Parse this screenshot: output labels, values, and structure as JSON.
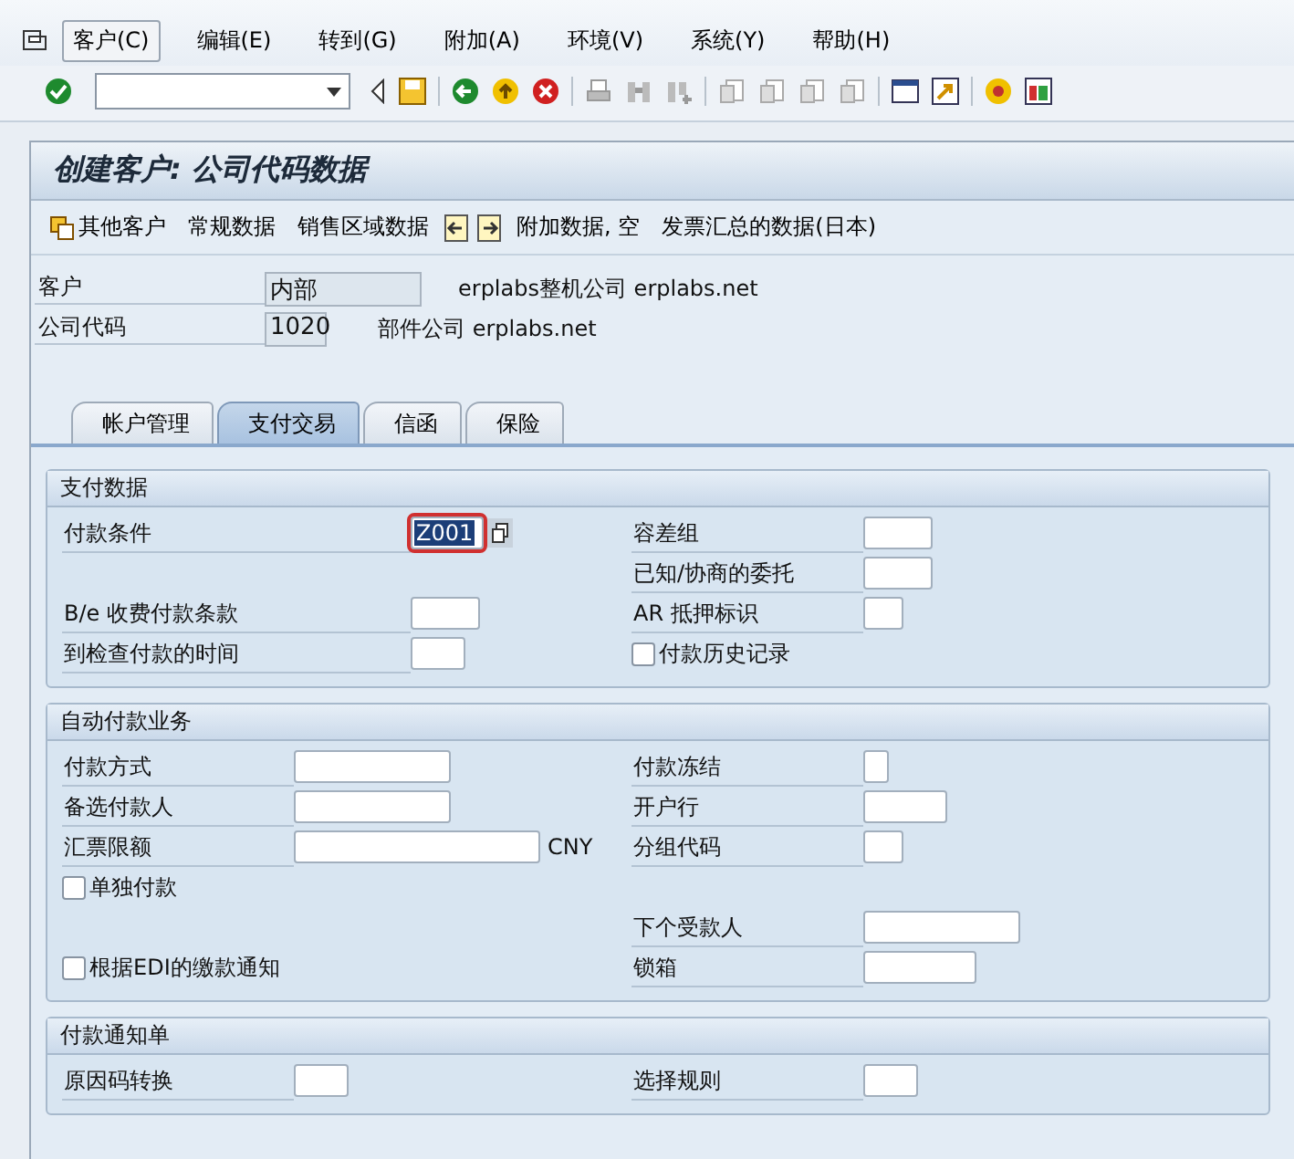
{
  "menu_bar": {
    "items": [
      {
        "label": "客户(C)",
        "selected": true
      },
      {
        "label": "编辑(E)",
        "selected": false
      },
      {
        "label": "转到(G)",
        "selected": false
      },
      {
        "label": "附加(A)",
        "selected": false
      },
      {
        "label": "环境(V)",
        "selected": false
      },
      {
        "label": "系统(Y)",
        "selected": false
      },
      {
        "label": "帮助(H)",
        "selected": false
      }
    ]
  },
  "title": "创建客户: 公司代码数据",
  "app_toolbar": [
    {
      "kind": "icon-text",
      "label": "其他客户"
    },
    {
      "kind": "text",
      "label": "常规数据"
    },
    {
      "kind": "text",
      "label": "销售区域数据"
    },
    {
      "kind": "previous"
    },
    {
      "kind": "next"
    },
    {
      "kind": "text",
      "label": "附加数据, 空"
    },
    {
      "kind": "text",
      "label": "发票汇总的数据(日本)"
    }
  ],
  "header_fields": [
    {
      "label": "客户",
      "value": "内部",
      "description": "erplabs整机公司 erplabs.net"
    },
    {
      "label": "公司代码",
      "value": "1020",
      "description": "部件公司 erplabs.net"
    }
  ],
  "tabs": [
    {
      "label": "帐户管理",
      "selected": false
    },
    {
      "label": "支付交易",
      "selected": true
    },
    {
      "label": "信函",
      "selected": false
    },
    {
      "label": "保险",
      "selected": false
    }
  ],
  "groups": [
    {
      "title": "支付数据",
      "rows": [
        {
          "left": {
            "kind": "field",
            "label": "付款条件",
            "value": "Z001",
            "focused": true
          },
          "right": {
            "kind": "field",
            "label": "容差组",
            "focused": false
          }
        },
        {
          "right": {
            "kind": "field",
            "label": "已知/协商的委托",
            "focused": false
          }
        },
        {
          "left": {
            "kind": "field",
            "label": "B/e 收费付款条款",
            "focused": false
          },
          "right": {
            "kind": "field",
            "label": "AR 抵押标识",
            "focused": false
          }
        },
        {
          "left": {
            "kind": "field",
            "label": "到检查付款的时间",
            "focused": false
          },
          "right": {
            "kind": "checkbox",
            "label": "付款历史记录",
            "checked": false
          }
        }
      ]
    },
    {
      "title": "自动付款业务",
      "rows": [
        {
          "left": {
            "kind": "field",
            "label": "付款方式",
            "focused": false
          },
          "right": {
            "kind": "field",
            "label": "付款冻结",
            "focused": false
          }
        },
        {
          "left": {
            "kind": "field",
            "label": "备选付款人",
            "focused": false
          },
          "right": {
            "kind": "field",
            "label": "开户行",
            "focused": false
          }
        },
        {
          "left": {
            "kind": "field",
            "label": "汇票限额",
            "suffix": "CNY",
            "focused": false
          },
          "right": {
            "kind": "field",
            "label": "分组代码",
            "focused": false
          }
        },
        {
          "left": {
            "kind": "checkbox",
            "label": "单独付款",
            "checked": false
          }
        },
        {
          "right": {
            "kind": "field",
            "label": "下个受款人",
            "focused": false
          }
        },
        {
          "left": {
            "kind": "checkbox",
            "label": "根据EDI的缴款通知",
            "checked": false
          },
          "right": {
            "kind": "field",
            "label": "锁箱",
            "focused": false
          }
        }
      ]
    },
    {
      "title": "付款通知单",
      "rows": [
        {
          "left": {
            "kind": "field",
            "label": "原因码转换",
            "focused": false
          },
          "right": {
            "kind": "field",
            "label": "选择规则",
            "focused": false
          }
        }
      ]
    }
  ]
}
